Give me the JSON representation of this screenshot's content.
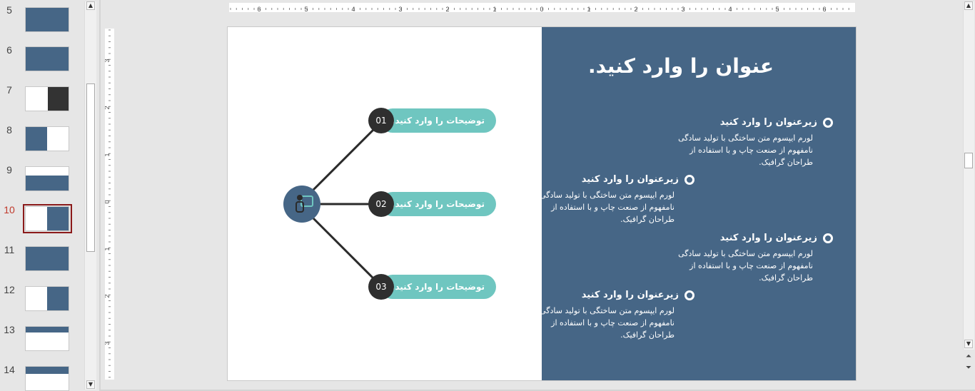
{
  "thumbnail_panel": {
    "slide_numbers": [
      "5",
      "6",
      "7",
      "8",
      "9",
      "10",
      "11",
      "12",
      "13",
      "14"
    ],
    "active_slide": "10"
  },
  "rulers": {
    "horizontal_labels": [
      "6",
      "5",
      "4",
      "3",
      "2",
      "1",
      "0",
      "1",
      "2",
      "3",
      "4",
      "5",
      "6"
    ],
    "vertical_labels": [
      "3",
      "2",
      "1",
      "0",
      "1",
      "2",
      "3"
    ]
  },
  "slide": {
    "title": "عنوان را وارد کنید.",
    "items": [
      {
        "heading": "زیرعنوان را وارد کنید",
        "body": "لورم ایپسوم متن ساختگی با تولید سادگی نامفهوم از صنعت چاپ و با استفاده از طراحان گرافیک."
      },
      {
        "heading": "زیرعنوان را وارد کنید",
        "body": "لورم ایپسوم متن ساختگی با تولید سادگی نامفهوم از صنعت چاپ و با استفاده از طراحان گرافیک."
      },
      {
        "heading": "زیرعنوان را وارد کنید",
        "body": "لورم ایپسوم متن ساختگی با تولید سادگی نامفهوم از صنعت چاپ و با استفاده از طراحان گرافیک."
      },
      {
        "heading": "زیرعنوان را وارد کنید",
        "body": "لورم ایپسوم متن ساختگی با تولید سادگی نامفهوم از صنعت چاپ و با استفاده از طراحان گرافیک."
      }
    ],
    "branches": [
      {
        "number": "01",
        "label": "توضیحات را وارد کنید."
      },
      {
        "number": "02",
        "label": "توضیحات را وارد کنید."
      },
      {
        "number": "03",
        "label": "توضیحات را وارد کنید."
      }
    ],
    "hub_icon": "person-chat-icon"
  },
  "colors": {
    "slide_blue": "#466686",
    "pill_teal": "#6fc6c0",
    "number_dark": "#2f2f2f",
    "active_border": "#8b1a1a"
  }
}
